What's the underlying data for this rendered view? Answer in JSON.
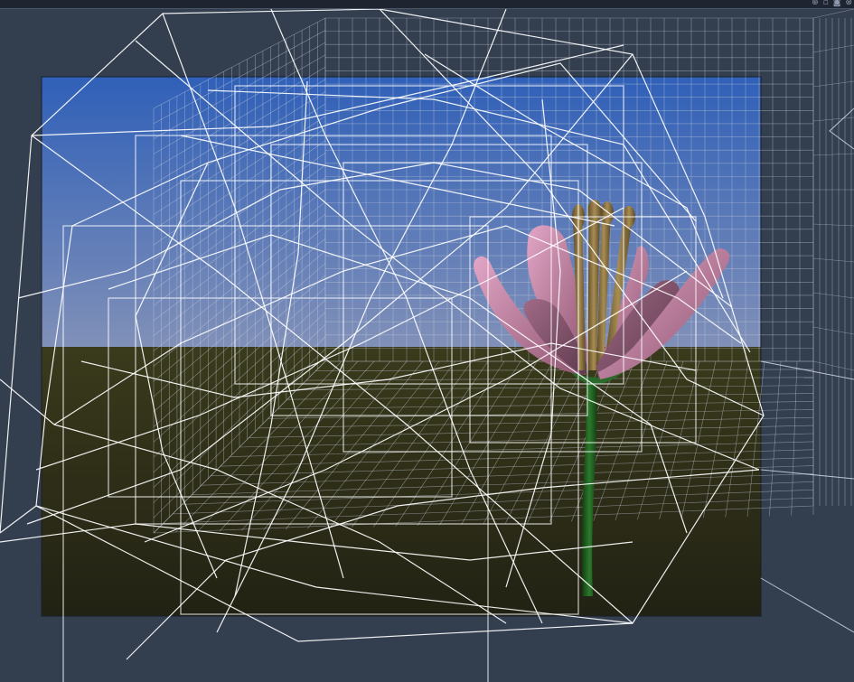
{
  "window": {
    "controls": [
      {
        "name": "pin-icon",
        "glyph": "⊕"
      },
      {
        "name": "restore-icon",
        "glyph": "▫"
      },
      {
        "name": "camera-icon",
        "glyph": "◙"
      },
      {
        "name": "close-icon",
        "glyph": "⊗"
      }
    ]
  },
  "scene": {
    "sky_top": "#3060b8",
    "sky_bottom": "#7f8fb8",
    "ground_top": "#3a3a1c",
    "ground_bottom": "#242414",
    "background": "#333e4f",
    "wireframe_color": "#ffffff",
    "grid_color": "#c8d0dc",
    "petal_color": "#d18fb0",
    "petal_shade": "#7e4a66",
    "stamen_color": "#8c7442",
    "stem_color": "#1f5a1f"
  }
}
